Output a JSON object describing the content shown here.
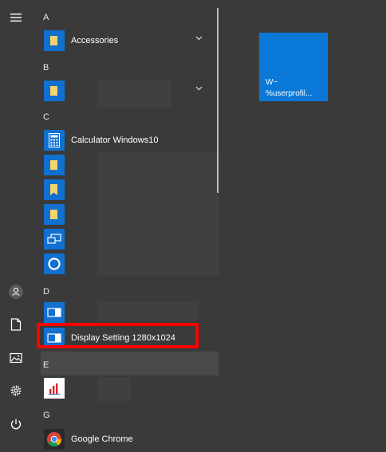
{
  "rail": {
    "items": [
      {
        "name": "expand-menu-button"
      },
      {
        "name": "user-account-button"
      },
      {
        "name": "documents-button"
      },
      {
        "name": "pictures-button"
      },
      {
        "name": "settings-button"
      },
      {
        "name": "power-button"
      }
    ]
  },
  "apps": {
    "letters": [
      "A",
      "B",
      "C",
      "D",
      "E",
      "G"
    ],
    "accessories": "Accessories",
    "calculator": "Calculator Windows10",
    "display_setting": "Display Setting 1280x1024",
    "chrome": "Google Chrome"
  },
  "tiles": [
    {
      "line1": "W~",
      "line2": "%userprofil..."
    }
  ],
  "colors": {
    "background": "#3a3a3a",
    "accent": "#0a78d7",
    "icon_blue": "#1270d0",
    "folder_yellow": "#f6d36b",
    "highlight": "#ff0000"
  }
}
